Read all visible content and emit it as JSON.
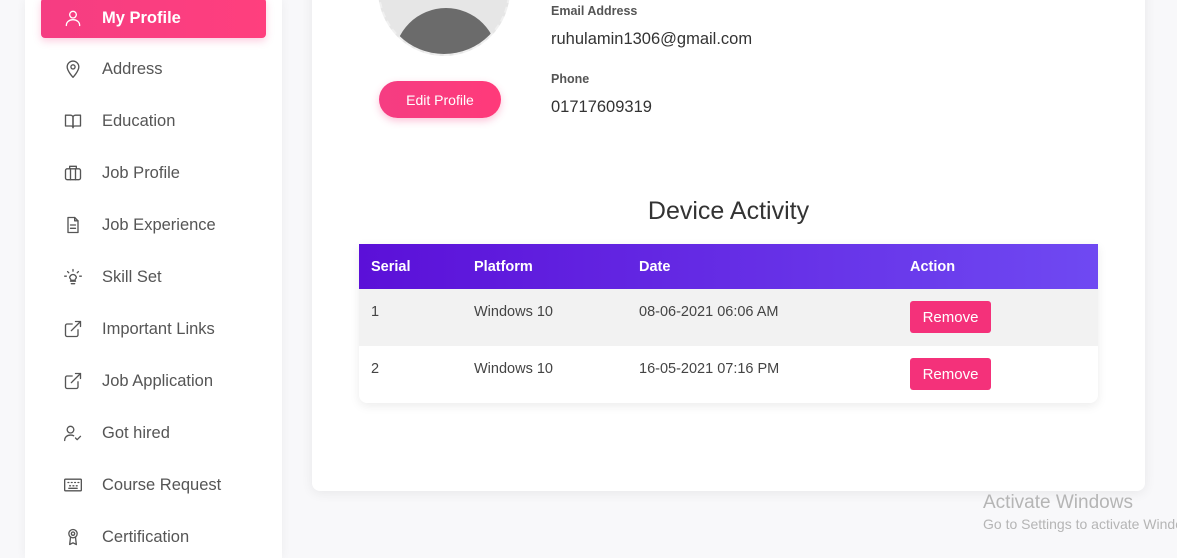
{
  "sidebar": {
    "items": [
      {
        "label": "My Profile",
        "icon": "user-icon",
        "active": true
      },
      {
        "label": "Address",
        "icon": "location-pin-icon"
      },
      {
        "label": "Education",
        "icon": "book-icon"
      },
      {
        "label": "Job Profile",
        "icon": "briefcase-icon"
      },
      {
        "label": "Job Experience",
        "icon": "document-icon"
      },
      {
        "label": "Skill Set",
        "icon": "lightbulb-icon"
      },
      {
        "label": "Important Links",
        "icon": "external-link-icon"
      },
      {
        "label": "Job Application",
        "icon": "external-link-icon"
      },
      {
        "label": "Got hired",
        "icon": "user-check-icon"
      },
      {
        "label": "Course Request",
        "icon": "keyboard-icon"
      },
      {
        "label": "Certification",
        "icon": "award-icon"
      }
    ]
  },
  "profile": {
    "edit_label": "Edit Profile",
    "email_label": "Email Address",
    "email_value": "ruhulamin1306@gmail.com",
    "phone_label": "Phone",
    "phone_value": "01717609319"
  },
  "device_activity": {
    "title": "Device Activity",
    "columns": [
      "Serial",
      "Platform",
      "Date",
      "Action"
    ],
    "rows": [
      {
        "serial": "1",
        "platform": "Windows 10",
        "date": "08-06-2021 06:06 AM",
        "action": "Remove"
      },
      {
        "serial": "2",
        "platform": "Windows 10",
        "date": "16-05-2021 07:16 PM",
        "action": "Remove"
      }
    ]
  },
  "watermark": {
    "line1": "Activate Windows",
    "line2": "Go to Settings to activate Windows."
  },
  "colors": {
    "accent": "#f53d82",
    "table_header_start": "#5b10d8",
    "table_header_end": "#6f49f2"
  }
}
